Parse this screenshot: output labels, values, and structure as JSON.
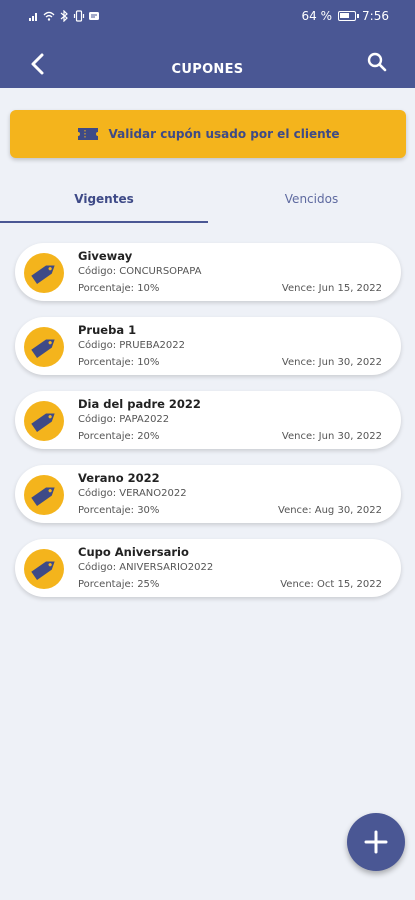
{
  "status_bar": {
    "battery": "64 %",
    "time": "7:56"
  },
  "header": {
    "title": "CUPONES"
  },
  "validate_button": {
    "label": "Validar cupón usado por el cliente"
  },
  "tabs": [
    {
      "label": "Vigentes"
    },
    {
      "label": "Vencidos"
    }
  ],
  "coupons": [
    {
      "name": "Giveway",
      "code": "Código: CONCURSOPAPA",
      "percent": "Porcentaje: 10%",
      "expires": "Vence: Jun 15, 2022"
    },
    {
      "name": "Prueba 1",
      "code": "Código: PRUEBA2022",
      "percent": "Porcentaje: 10%",
      "expires": "Vence: Jun 30, 2022"
    },
    {
      "name": "Dia del padre 2022",
      "code": "Código: PAPA2022",
      "percent": "Porcentaje: 20%",
      "expires": "Vence: Jun 30, 2022"
    },
    {
      "name": "Verano 2022",
      "code": "Código: VERANO2022",
      "percent": "Porcentaje: 30%",
      "expires": "Vence: Aug 30, 2022"
    },
    {
      "name": "Cupo Aniversario",
      "code": "Código: ANIVERSARIO2022",
      "percent": "Porcentaje: 25%",
      "expires": "Vence: Oct 15, 2022"
    }
  ],
  "colors": {
    "primary": "#4a5794",
    "accent": "#f4b41c",
    "background": "#eef1f7"
  }
}
